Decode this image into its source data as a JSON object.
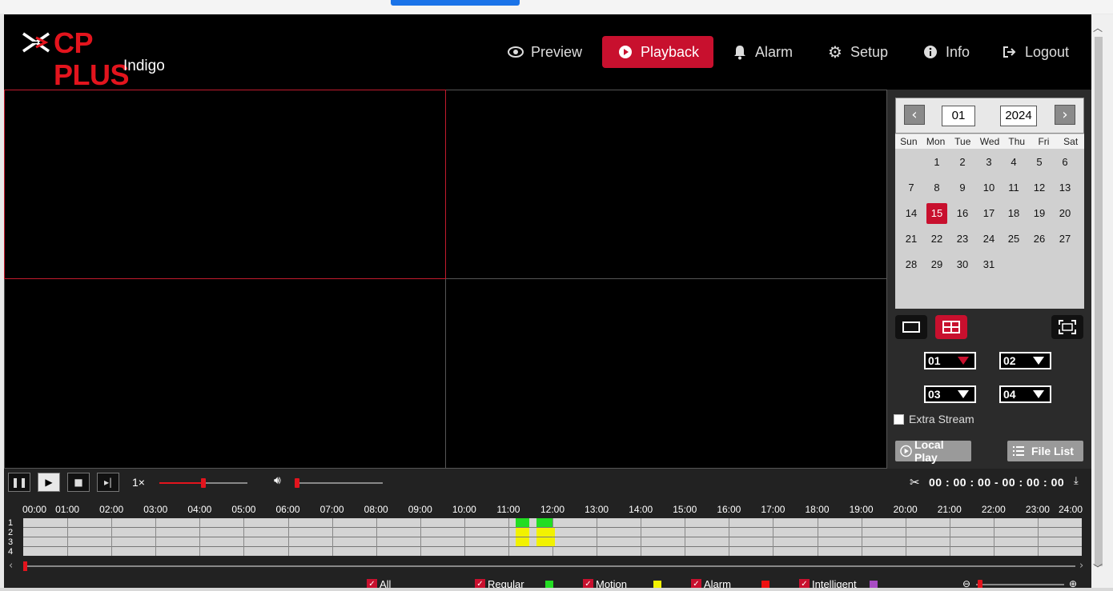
{
  "brand": {
    "name": "CP PLUS",
    "sub": "Indigo",
    "accent": "#c8102e"
  },
  "nav": [
    {
      "label": "Preview",
      "icon": "eye-icon"
    },
    {
      "label": "Playback",
      "icon": "play-circle-icon",
      "active": true
    },
    {
      "label": "Alarm",
      "icon": "bell-icon"
    },
    {
      "label": "Setup",
      "icon": "gear-icon"
    },
    {
      "label": "Info",
      "icon": "info-icon"
    },
    {
      "label": "Logout",
      "icon": "logout-icon"
    }
  ],
  "calendar": {
    "month": "01",
    "year": "2024",
    "weekdays": [
      "Sun",
      "Mon",
      "Tue",
      "Wed",
      "Thu",
      "Fri",
      "Sat"
    ],
    "selected_day": 15,
    "days": [
      "1",
      "2",
      "3",
      "4",
      "5",
      "6",
      "7",
      "8",
      "9",
      "10",
      "11",
      "12",
      "13",
      "14",
      "15",
      "16",
      "17",
      "18",
      "19",
      "20",
      "21",
      "22",
      "23",
      "24",
      "25",
      "26",
      "27",
      "28",
      "29",
      "30",
      "31"
    ]
  },
  "channels": [
    "01",
    "02",
    "03",
    "04"
  ],
  "extra_stream": "Extra Stream",
  "buttons": {
    "local_play": "Local Play",
    "file_list": "File List"
  },
  "playback": {
    "speed": "1×",
    "speed_level": 0.5,
    "volume_level": 0.0,
    "time_range": "00 : 00 : 00 - 00 : 00 : 00"
  },
  "timeline": {
    "hours": [
      "00:00",
      "01:00",
      "02:00",
      "03:00",
      "04:00",
      "05:00",
      "06:00",
      "07:00",
      "08:00",
      "09:00",
      "10:00",
      "11:00",
      "12:00",
      "13:00",
      "14:00",
      "15:00",
      "16:00",
      "17:00",
      "18:00",
      "19:00",
      "20:00",
      "21:00",
      "22:00",
      "23:00",
      "24:00"
    ],
    "rows": [
      "1",
      "2",
      "3",
      "4"
    ],
    "records": [
      {
        "row": 1,
        "type": "regular",
        "start": "11:10",
        "end": "11:28"
      },
      {
        "row": 1,
        "type": "regular",
        "start": "11:38",
        "end": "12:00"
      },
      {
        "row": 2,
        "type": "motion",
        "start": "11:10",
        "end": "11:28"
      },
      {
        "row": 2,
        "type": "motion",
        "start": "11:38",
        "end": "12:03"
      },
      {
        "row": 3,
        "type": "motion",
        "start": "11:10",
        "end": "11:28"
      },
      {
        "row": 3,
        "type": "motion",
        "start": "11:38",
        "end": "12:03"
      }
    ]
  },
  "legend": [
    {
      "label": "All",
      "color": ""
    },
    {
      "label": "Regular",
      "color": "#22dd22"
    },
    {
      "label": "Motion",
      "color": "#f2f200"
    },
    {
      "label": "Alarm",
      "color": "#ee1111"
    },
    {
      "label": "Intelligent",
      "color": "#a84cc4"
    }
  ]
}
